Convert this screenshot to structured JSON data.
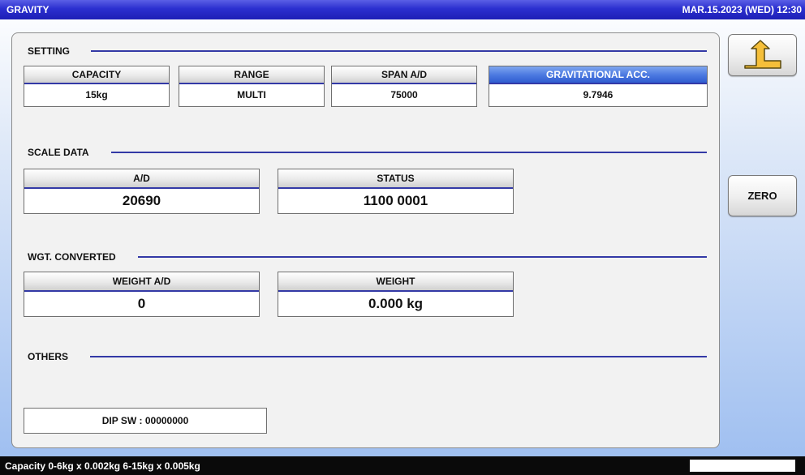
{
  "title_bar": {
    "title": "GRAVITY",
    "datetime": "MAR.15.2023 (WED)  12:30"
  },
  "setting": {
    "title": "SETTING",
    "fields": [
      {
        "label": "CAPACITY",
        "value": "15kg",
        "selected": false
      },
      {
        "label": "RANGE",
        "value": "MULTI",
        "selected": false
      },
      {
        "label": "SPAN A/D",
        "value": "75000",
        "selected": false
      },
      {
        "label": "GRAVITATIONAL ACC.",
        "value": "9.7946",
        "selected": true
      }
    ]
  },
  "scale_data": {
    "title": "SCALE DATA",
    "fields": [
      {
        "label": "A/D",
        "value": "20690"
      },
      {
        "label": "STATUS",
        "value": "1100 0001"
      }
    ]
  },
  "wgt_converted": {
    "title": "WGT. CONVERTED",
    "fields": [
      {
        "label": "WEIGHT A/D",
        "value": "0"
      },
      {
        "label": "WEIGHT",
        "value": "0.000 kg"
      }
    ]
  },
  "others": {
    "title": "OTHERS",
    "dip_sw": "DIP SW : 00000000"
  },
  "side_buttons": {
    "back_icon": "return-arrow-icon",
    "zero_label": "ZERO"
  },
  "status_bar": {
    "message": "Capacity 0-6kg x 0.002kg  6-15kg x 0.005kg"
  },
  "colors": {
    "title_bar": "#2b2fcf",
    "accent_line": "#3339a6",
    "selected_header": "#4a78e0",
    "icon_fill": "#f5bf3a"
  }
}
